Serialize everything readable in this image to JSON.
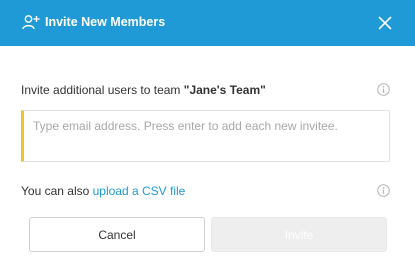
{
  "dialog": {
    "title": "Invite New Members",
    "header_color": "#1f9ad6",
    "header_icon": "add-user-icon",
    "close_icon": "close-icon"
  },
  "invite": {
    "label_prefix": "Invite additional users to team ",
    "team_name": "\"Jane's Team\"",
    "info_icon": "info-icon"
  },
  "email_input": {
    "placeholder": "Type email address. Press enter to add each new invitee.",
    "value": "",
    "accent_color": "#f2c232"
  },
  "csv": {
    "prefix": "You can also ",
    "link_label": "upload a CSV file",
    "info_icon": "info-icon"
  },
  "buttons": {
    "cancel_label": "Cancel",
    "invite_label": "Invite"
  }
}
